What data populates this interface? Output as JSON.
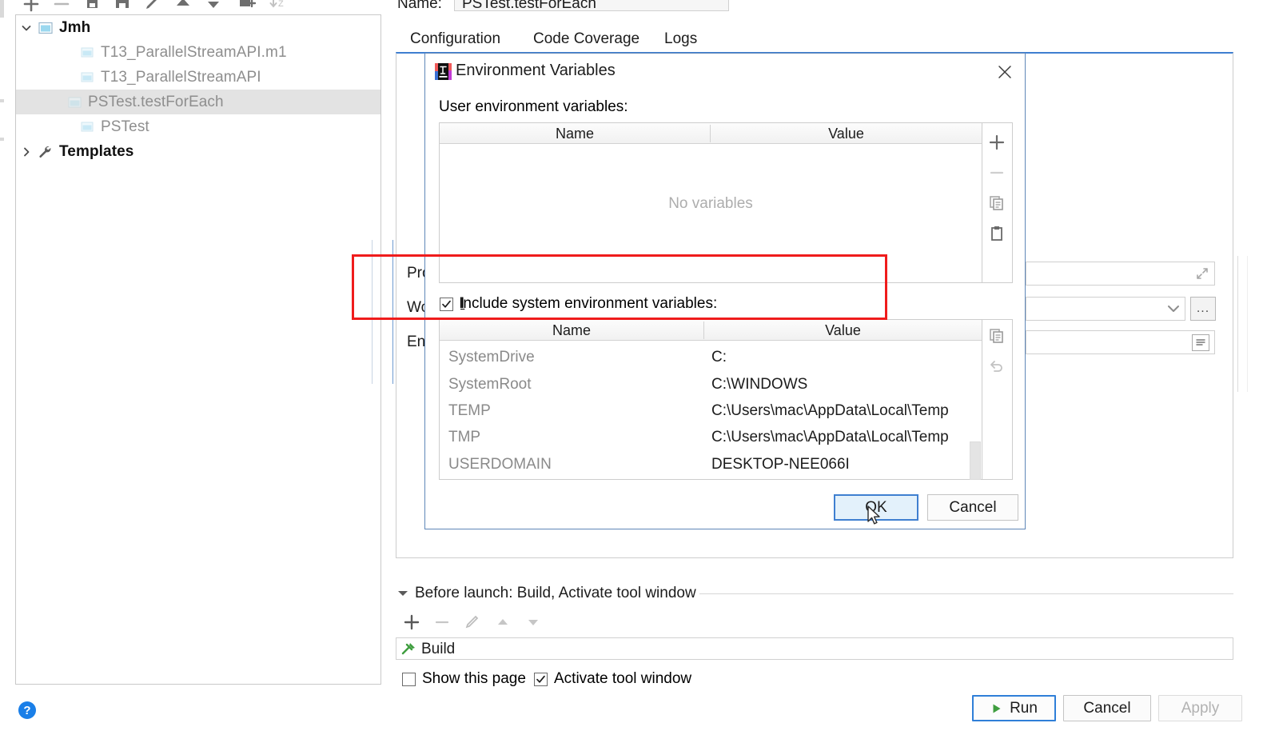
{
  "toolbar": {
    "icons": [
      "plus-icon",
      "minus-icon",
      "copy-config-icon",
      "save-icon",
      "edit-icon",
      "move-up-icon",
      "move-down-icon",
      "new-folder-icon",
      "sort-az-icon"
    ]
  },
  "sidebar": {
    "items": [
      {
        "label": "Jmh",
        "icon": "folder-icon",
        "bold": true,
        "expanded": true,
        "depth": 0,
        "selected": false
      },
      {
        "label": "T13_ParallelStreamAPI.m1",
        "icon": "run-config-icon",
        "bold": false,
        "depth": 1,
        "selected": false
      },
      {
        "label": "T13_ParallelStreamAPI",
        "icon": "run-config-icon",
        "bold": false,
        "depth": 1,
        "selected": false
      },
      {
        "label": "PSTest.testForEach",
        "icon": "run-config-icon",
        "bold": false,
        "depth": 1,
        "selected": true
      },
      {
        "label": "PSTest",
        "icon": "run-config-icon",
        "bold": false,
        "depth": 1,
        "selected": false
      },
      {
        "label": "Templates",
        "icon": "wrench-icon",
        "bold": true,
        "expanded": false,
        "depth": 0,
        "selected": false
      }
    ]
  },
  "header": {
    "name_label": "Name:",
    "name_value": "PSTest.testForEach"
  },
  "tabs": [
    {
      "label": "Configuration",
      "active": true
    },
    {
      "label": "Code Coverage",
      "active": false
    },
    {
      "label": "Logs",
      "active": false
    }
  ],
  "config_form": {
    "program_arguments_label": "Pro",
    "working_directory_label": "Wo",
    "environment_variables_label": "Env"
  },
  "before_launch": {
    "header": "Before launch: Build, Activate tool window",
    "toolbar_icons": [
      "plus-icon",
      "minus-icon",
      "edit-icon",
      "move-up-icon",
      "move-down-icon"
    ],
    "task_label": "Build",
    "task_icon": "hammer-icon",
    "show_page_label": "Show this page",
    "show_page_checked": false,
    "activate_tool_window_label": "Activate tool window",
    "activate_tool_window_checked": true
  },
  "footer": {
    "run_label": "Run",
    "cancel_label": "Cancel",
    "apply_label": "Apply",
    "apply_enabled": false,
    "help_icon": "help-icon",
    "help_glyph": "?"
  },
  "dialog": {
    "title": "Environment Variables",
    "icon": "intellij-idea-icon",
    "close_glyph": "✕",
    "user_variables_label": "User environment variables:",
    "user_table": {
      "columns": [
        "Name",
        "Value"
      ],
      "rows": [],
      "empty_message": "No variables"
    },
    "user_toolbar": [
      "add-icon",
      "remove-icon",
      "copy-icon",
      "paste-icon"
    ],
    "include_system": {
      "label": "Include system environment variables:",
      "checked": true,
      "check_glyph": "✓"
    },
    "system_table": {
      "columns": [
        "Name",
        "Value"
      ],
      "rows": [
        {
          "name": "SystemDrive",
          "value": "C:"
        },
        {
          "name": "SystemRoot",
          "value": "C:\\WINDOWS"
        },
        {
          "name": "TEMP",
          "value": "C:\\Users\\mac\\AppData\\Local\\Temp"
        },
        {
          "name": "TMP",
          "value": "C:\\Users\\mac\\AppData\\Local\\Temp"
        },
        {
          "name": "USERDOMAIN",
          "value": "DESKTOP-NEE066I"
        }
      ]
    },
    "system_toolbar": [
      "copy-icon",
      "revert-icon"
    ],
    "ok_label": "OK",
    "cancel_label": "Cancel"
  },
  "annotation": {
    "color": "#ef1c1c",
    "shape": "rectangle"
  },
  "colors": {
    "accent": "#3f7fd0",
    "selection": "#e3e3e3",
    "focus_fill": "#e3f1fb",
    "annotation": "#ef1c1c",
    "run_green": "#3f9e3f"
  }
}
